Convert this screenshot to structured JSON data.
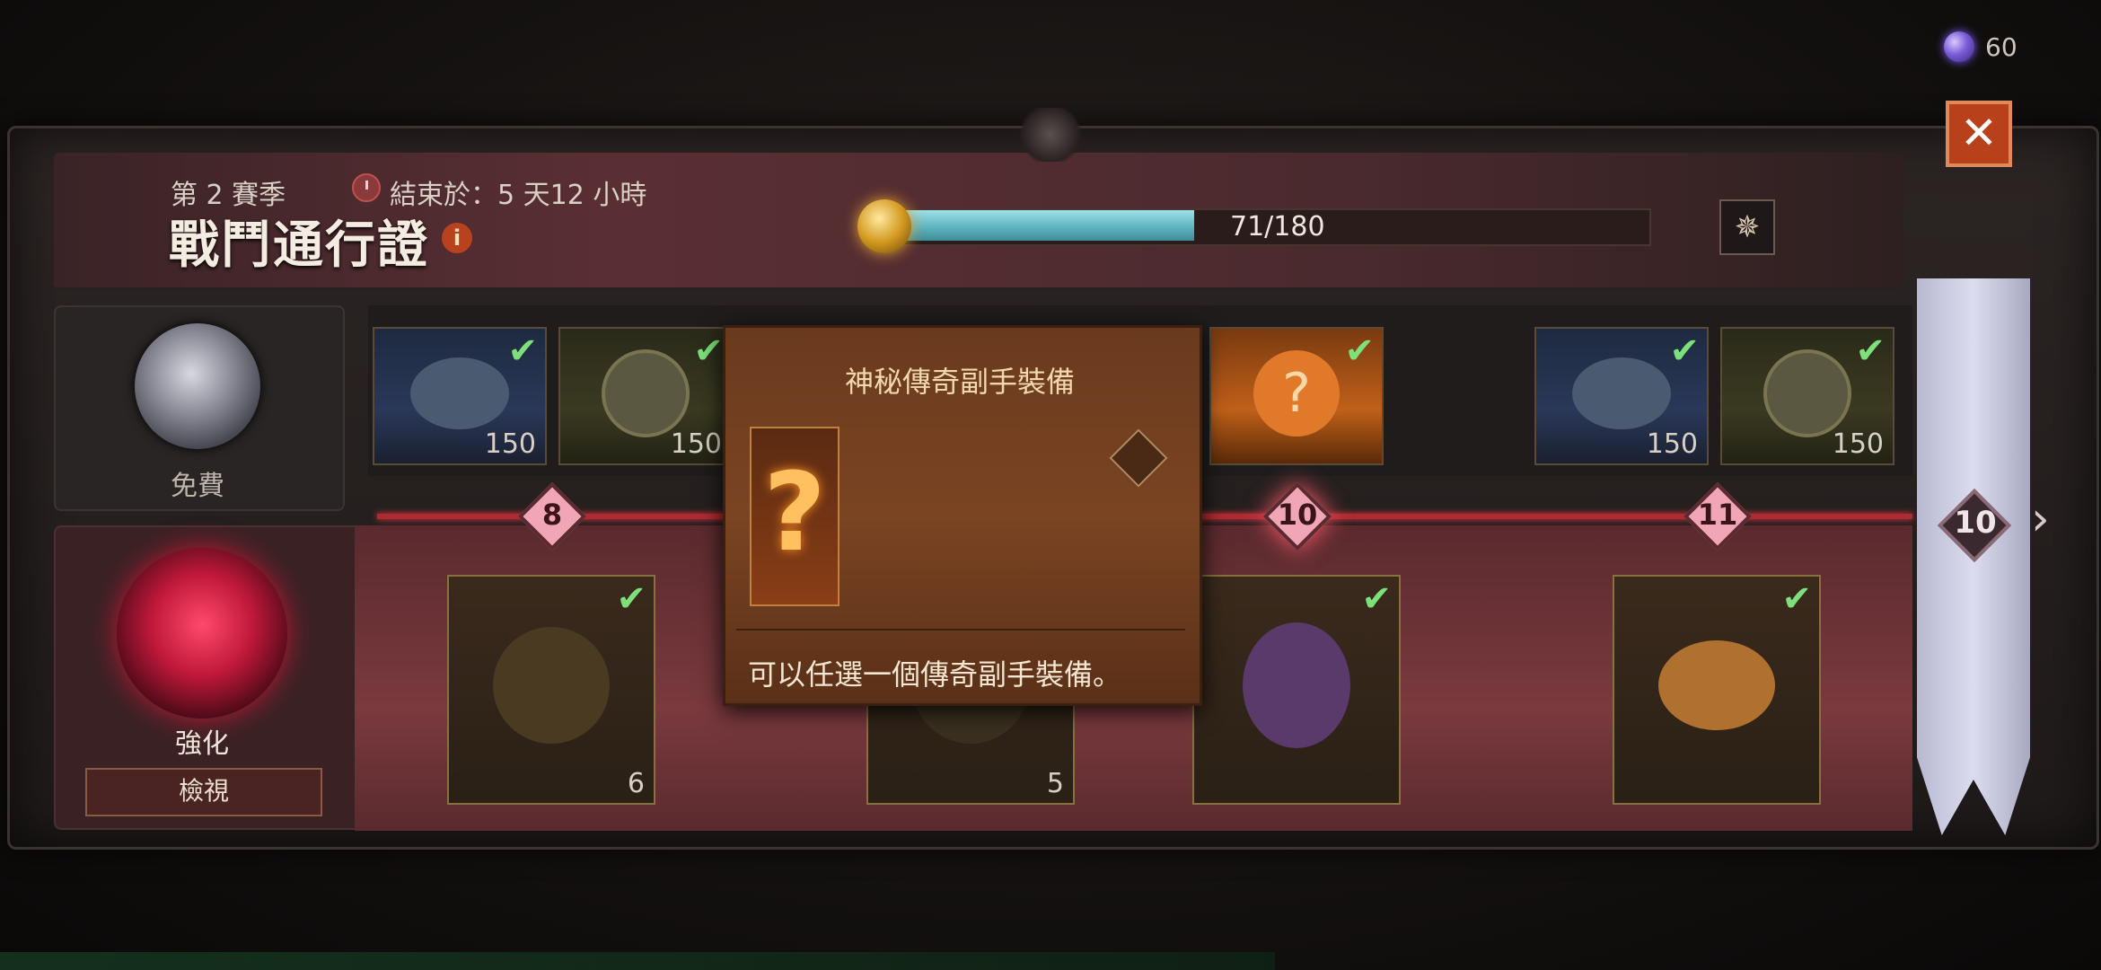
{
  "currency": {
    "icon": "purple-orb-icon",
    "value": "60"
  },
  "header": {
    "season": "第 2 賽季",
    "end_time": "結束於：5 天12 小時",
    "title": "戰鬥通行證",
    "info_icon": "i"
  },
  "progress": {
    "current": 71,
    "max": 180,
    "text": "71/180",
    "fraction": 0.394
  },
  "buttons": {
    "close": "✕",
    "compass": "✵",
    "view": "檢視"
  },
  "tracks": {
    "free_label": "免費",
    "premium_label": "強化"
  },
  "free_rewards": [
    {
      "amount": "150",
      "claimed": true,
      "style": "blue"
    },
    {
      "amount": "150",
      "claimed": true,
      "style": "olive"
    },
    {
      "amount": "",
      "claimed": true,
      "style": "orange"
    },
    {
      "amount": "150",
      "claimed": true,
      "style": "blue"
    },
    {
      "amount": "150",
      "claimed": true,
      "style": "olive"
    }
  ],
  "premium_rewards": [
    {
      "amount": "6",
      "claimed": true
    },
    {
      "amount": "5",
      "claimed": false
    },
    {
      "amount": "",
      "claimed": true
    },
    {
      "amount": "",
      "claimed": true
    }
  ],
  "levels": [
    "8",
    "10",
    "11"
  ],
  "banner_level": "10",
  "next_arrow": "›",
  "tooltip": {
    "title": "神秘傳奇副手裝備",
    "item_glyph": "?",
    "description": "可以任選一個傳奇副手裝備。"
  },
  "colors": {
    "accent": "#b8401a",
    "progress": "#5ab0bc",
    "claimed_check": "#7ee07a"
  }
}
